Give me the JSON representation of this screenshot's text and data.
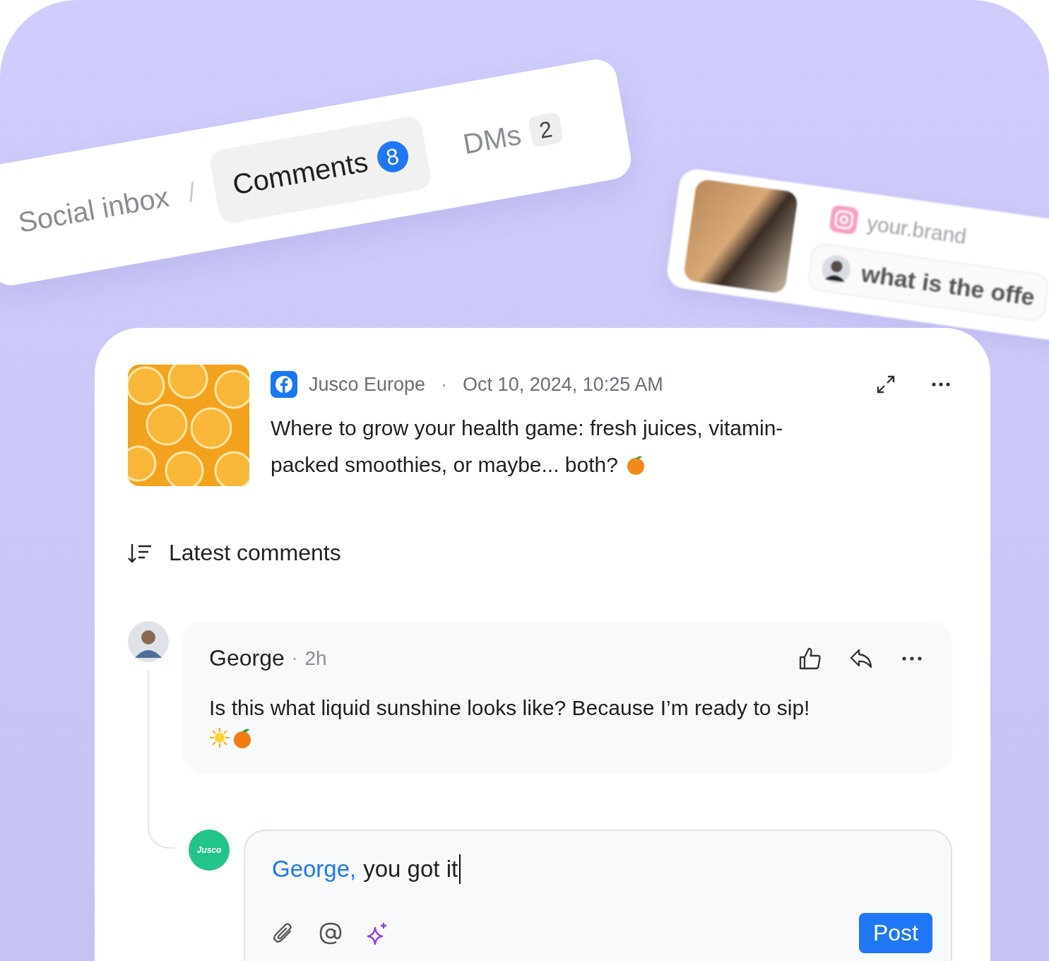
{
  "breadcrumb": {
    "root": "Social inbox",
    "separator": "/"
  },
  "tabs": [
    {
      "label": "Comments",
      "count": "8",
      "selected": true
    },
    {
      "label": "DMs",
      "count": "2",
      "selected": false
    }
  ],
  "background_card": {
    "account": "your.brand",
    "message": "what is the offe"
  },
  "post": {
    "author": "Jusco Europe",
    "separator": "·",
    "time": "Oct 10, 2024, 10:25 AM",
    "text_lines": [
      "Where to grow your health game: fresh juices, vitamin-",
      "packed smoothies, or maybe... both?"
    ]
  },
  "sort": {
    "label": "Latest comments"
  },
  "comments": [
    {
      "author": "George",
      "separator": "·",
      "age": "2h",
      "text": "Is this what liquid sunshine looks like? Because I’m ready to sip!"
    }
  ],
  "reply": {
    "avatar_text": "Jusco",
    "mention": "George,",
    "value": "you got it",
    "button": "Post"
  }
}
